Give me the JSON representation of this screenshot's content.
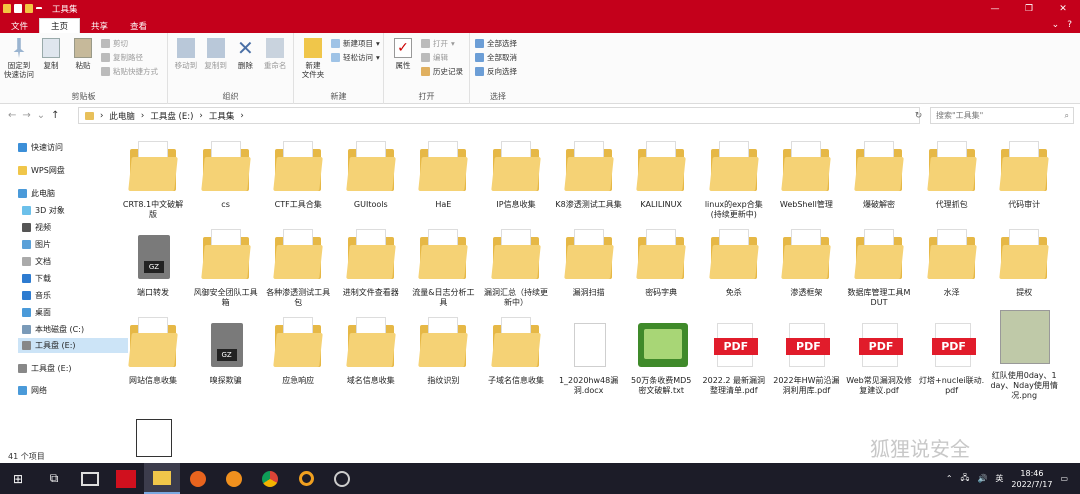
{
  "window": {
    "title": "工具集"
  },
  "ribbon_tabs": [
    "文件",
    "主页",
    "共享",
    "查看"
  ],
  "ribbon": {
    "clipboard": {
      "label": "剪贴板",
      "pin": "固定到\n快速访问",
      "copy": "复制",
      "paste": "粘贴",
      "cut": "剪切",
      "copy_path": "复制路径",
      "paste_shortcut": "粘贴快捷方式"
    },
    "organize": {
      "label": "组织",
      "move_to": "移动到",
      "copy_to": "复制到",
      "delete": "删除",
      "rename": "重命名"
    },
    "new": {
      "label": "新建",
      "new_folder": "新建\n文件夹",
      "new_item": "新建项目",
      "easy_access": "轻松访问"
    },
    "open": {
      "label": "打开",
      "properties": "属性",
      "open": "打开",
      "edit": "编辑",
      "history": "历史记录"
    },
    "select": {
      "label": "选择",
      "select_all": "全部选择",
      "select_none": "全部取消",
      "invert": "反向选择"
    }
  },
  "address": {
    "crumbs": [
      "此电脑",
      "工具盘 (E:)",
      "工具集"
    ],
    "search_placeholder": "搜索\"工具集\""
  },
  "nav": {
    "quick_access": "快速访问",
    "wps": "WPS网盘",
    "this_pc": "此电脑",
    "objects3d": "3D 对象",
    "videos": "视频",
    "pictures": "图片",
    "documents": "文档",
    "downloads": "下载",
    "music": "音乐",
    "desktop": "桌面",
    "local_c": "本地磁盘 (C:)",
    "tool_e": "工具盘 (E:)",
    "tool_e2": "工具盘 (E:)",
    "network": "网络"
  },
  "files": [
    {
      "name": "CRT8.1中文破解版",
      "type": "folder"
    },
    {
      "name": "cs",
      "type": "folder"
    },
    {
      "name": "CTF工具合集",
      "type": "folder"
    },
    {
      "name": "GUItools",
      "type": "folder"
    },
    {
      "name": "HaE",
      "type": "folder"
    },
    {
      "name": "IP信息收集",
      "type": "folder"
    },
    {
      "name": "K8渗透测试工具集",
      "type": "folder"
    },
    {
      "name": "KALILINUX",
      "type": "folder"
    },
    {
      "name": "linux的exp合集(持续更新中)",
      "type": "folder"
    },
    {
      "name": "WebShell管理",
      "type": "folder"
    },
    {
      "name": "爆破解密",
      "type": "folder"
    },
    {
      "name": "代理抓包",
      "type": "folder"
    },
    {
      "name": "代码审计",
      "type": "folder"
    },
    {
      "name": "端口转发",
      "type": "gz"
    },
    {
      "name": "风御安全团队工具箱",
      "type": "folder"
    },
    {
      "name": "各种渗透测试工具包",
      "type": "folder"
    },
    {
      "name": "进制文件查看器",
      "type": "folder"
    },
    {
      "name": "流量&日志分析工具",
      "type": "folder"
    },
    {
      "name": "漏洞汇总（持续更新中）",
      "type": "folder"
    },
    {
      "name": "漏洞扫描",
      "type": "folder"
    },
    {
      "name": "密码字典",
      "type": "folder"
    },
    {
      "name": "免杀",
      "type": "folder"
    },
    {
      "name": "渗透框架",
      "type": "folder"
    },
    {
      "name": "数据库管理工具MDUT",
      "type": "folder"
    },
    {
      "name": "水泽",
      "type": "folder"
    },
    {
      "name": "提权",
      "type": "folder"
    },
    {
      "name": "网站信息收集",
      "type": "folder"
    },
    {
      "name": "嗅探欺骗",
      "type": "gz"
    },
    {
      "name": "应急响应",
      "type": "folder"
    },
    {
      "name": "域名信息收集",
      "type": "folder"
    },
    {
      "name": "指纹识别",
      "type": "folder"
    },
    {
      "name": "子域名信息收集",
      "type": "folder"
    },
    {
      "name": "1_2020hw48漏洞.docx",
      "type": "doc"
    },
    {
      "name": "50万条收费MD5密文破解.txt",
      "type": "notepad"
    },
    {
      "name": "2022.2 最新漏洞整理清单.pdf",
      "type": "pdf"
    },
    {
      "name": "2022年HW前沿漏洞利用库.pdf",
      "type": "pdf"
    },
    {
      "name": "Web常见漏洞及修复建议.pdf",
      "type": "pdf"
    },
    {
      "name": "灯塔+nuclei联动.pdf",
      "type": "pdf"
    },
    {
      "name": "红队使用0day、1day、Nday使用情况.png",
      "type": "xls"
    },
    {
      "name": "",
      "type": "qr"
    }
  ],
  "pdf_label": "PDF",
  "gz_label": "GZ",
  "status": {
    "count": "41 个项目"
  },
  "watermark": "狐狸说安全",
  "taskbar": {
    "time": "18:46",
    "date": "2022/7/17",
    "ime": "英"
  }
}
